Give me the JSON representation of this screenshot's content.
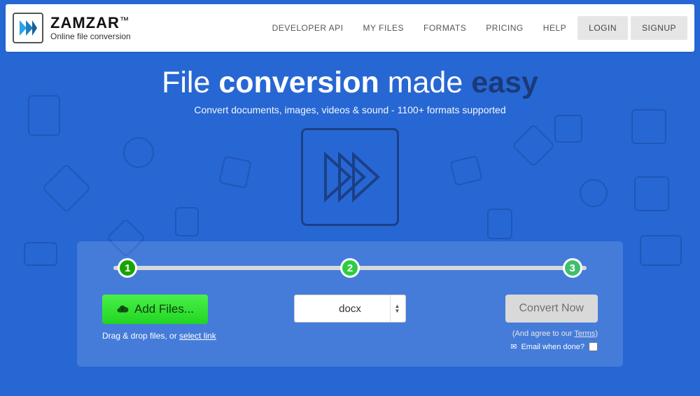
{
  "brand": {
    "name": "ZAMZAR",
    "tm": "™",
    "tagline": "Online file conversion"
  },
  "nav": {
    "items": [
      "DEVELOPER API",
      "MY FILES",
      "FORMATS",
      "PRICING",
      "HELP"
    ],
    "login": "LOGIN",
    "signup": "SIGNUP"
  },
  "hero": {
    "t1": "File ",
    "t2": "conversion",
    "t3": " made ",
    "t4": "easy",
    "sub": "Convert documents, images, videos & sound - 1100+ formats supported"
  },
  "steps": {
    "s1": "1",
    "s2": "2",
    "s3": "3"
  },
  "actions": {
    "add_files": "Add Files...",
    "drag_hint_pre": "Drag & drop files, or ",
    "drag_hint_link": "select link",
    "format_selected": "docx",
    "convert": "Convert Now",
    "terms_pre": "(And agree to our ",
    "terms_link": "Terms",
    "terms_post": ")",
    "email_label": "Email when done?"
  }
}
